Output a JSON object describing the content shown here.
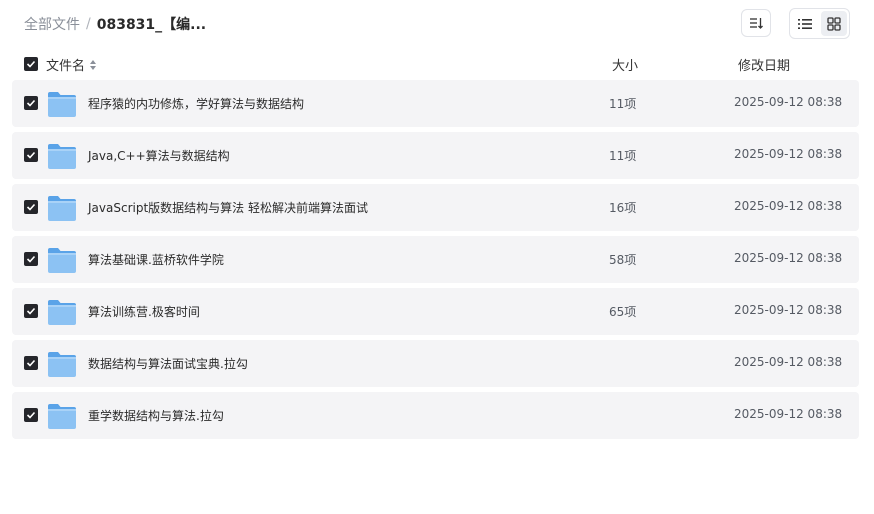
{
  "breadcrumb": {
    "root": "全部文件",
    "separator": "/",
    "current": "083831_【编..."
  },
  "toolbar": {
    "sort_icon": "sort-icon",
    "list_view_icon": "list-view-icon",
    "grid_view_icon": "grid-view-icon",
    "active_view": "list"
  },
  "columns": {
    "name": "文件名",
    "size": "大小",
    "date": "修改日期"
  },
  "colors": {
    "row_bg": "#f4f4f6",
    "checkbox": "#25262b",
    "folder": "#7ab7f0"
  },
  "files": [
    {
      "name": "程序猿的内功修炼，学好算法与数据结构",
      "size": "11项",
      "date": "2025-09-12 08:38",
      "checked": true
    },
    {
      "name": "Java,C++算法与数据结构",
      "size": "11项",
      "date": "2025-09-12 08:38",
      "checked": true
    },
    {
      "name": "JavaScript版数据结构与算法 轻松解决前端算法面试",
      "size": "16项",
      "date": "2025-09-12 08:38",
      "checked": true
    },
    {
      "name": "算法基础课.蓝桥软件学院",
      "size": "58项",
      "date": "2025-09-12 08:38",
      "checked": true
    },
    {
      "name": "算法训练营.极客时间",
      "size": "65项",
      "date": "2025-09-12 08:38",
      "checked": true
    },
    {
      "name": "数据结构与算法面试宝典.拉勾",
      "size": "",
      "date": "2025-09-12 08:38",
      "checked": true
    },
    {
      "name": "重学数据结构与算法.拉勾",
      "size": "",
      "date": "2025-09-12 08:38",
      "checked": true
    }
  ]
}
